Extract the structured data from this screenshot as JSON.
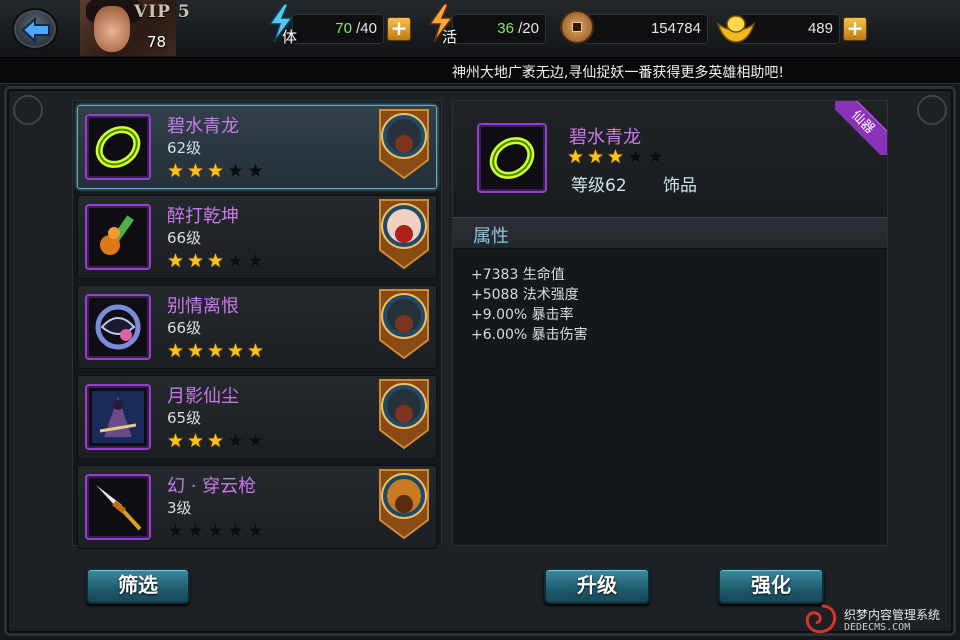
{
  "topbar": {
    "vip_label": "VIP 5",
    "player_level": "78",
    "stamina": {
      "label": "体",
      "current": "70",
      "max": "/40"
    },
    "energy": {
      "label": "活",
      "current": "36",
      "max": "/20"
    },
    "coins": "154784",
    "ingots": "489",
    "plus_symbol": "+"
  },
  "notice": "神州大地广袤无边,寻仙捉妖一番获得更多英雄相助吧!",
  "items": [
    {
      "name": "碧水青龙",
      "level": "62级",
      "stars": 3,
      "max_stars": 5,
      "selected": true,
      "icon": "jade-ring-icon",
      "hero": "bearded-warrior-portrait"
    },
    {
      "name": "醉打乾坤",
      "level": "66级",
      "stars": 3,
      "max_stars": 5,
      "selected": false,
      "icon": "gourd-icon",
      "hero": "red-hair-girl-portrait"
    },
    {
      "name": "别情离恨",
      "level": "66级",
      "stars": 5,
      "max_stars": 5,
      "selected": false,
      "icon": "mask-ring-icon",
      "hero": "bearded-warrior-portrait"
    },
    {
      "name": "月影仙尘",
      "level": "65级",
      "stars": 3,
      "max_stars": 5,
      "selected": false,
      "icon": "cloak-figure-icon",
      "hero": "bearded-warrior-portrait"
    },
    {
      "name": "幻 · 穿云枪",
      "level": "3级",
      "stars": 0,
      "max_stars": 5,
      "selected": false,
      "icon": "spear-icon",
      "hero": "armored-general-portrait"
    }
  ],
  "detail": {
    "name": "碧水青龙",
    "stars": 3,
    "max_stars": 5,
    "level_text": "等级62",
    "type": "饰品",
    "ribbon": "仙器",
    "section_title": "属性",
    "attributes": [
      "+7383 生命值",
      "+5088 法术强度",
      "+9.00% 暴击率",
      "+6.00% 暴击伤害"
    ]
  },
  "buttons": {
    "filter": "筛选",
    "upgrade": "升级",
    "enhance": "强化"
  },
  "watermark": {
    "line1": "织梦内容管理系统",
    "line2": "DEDECMS.COM"
  },
  "colors": {
    "purple_quality": "#9540c8",
    "star_on": "#ffc21c",
    "button_teal": "#2a7488"
  }
}
